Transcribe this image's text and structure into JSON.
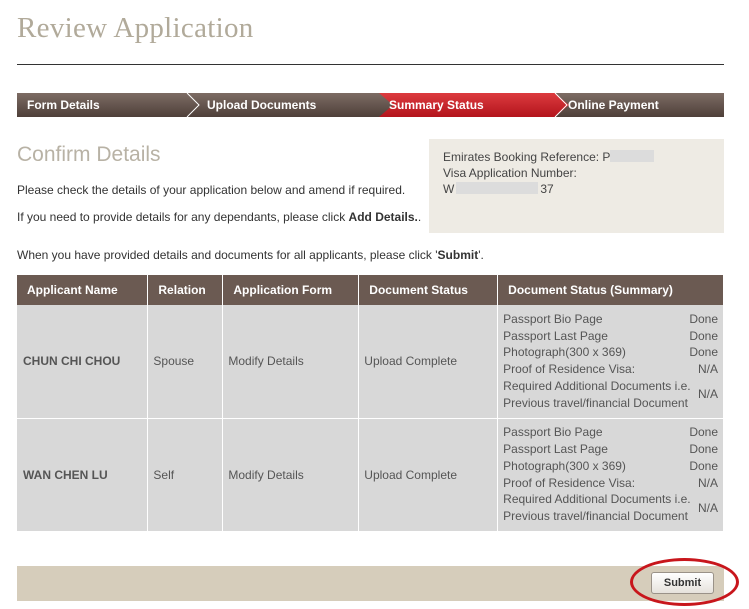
{
  "header": {
    "title": "Review Application"
  },
  "steps": [
    {
      "label": "Form Details",
      "active": false
    },
    {
      "label": "Upload Documents",
      "active": false
    },
    {
      "label": "Summary Status",
      "active": true
    },
    {
      "label": "Online Payment",
      "active": false
    }
  ],
  "confirm": {
    "title": "Confirm Details",
    "para1": "Please check the details of your application below and amend if required.",
    "para2_prefix": "If you need to provide details for any dependants, please click ",
    "para2_link": "Add Details.",
    "para2_suffix": ".",
    "para3_prefix": "When you have provided details and documents for all applicants, please click '",
    "para3_bold": "Submit",
    "para3_suffix": "'."
  },
  "booking": {
    "ref_label": "Emirates Booking Reference: P",
    "visa_label": "Visa Application Number:",
    "visa_prefix": "W",
    "visa_suffix": "37"
  },
  "table": {
    "headers": [
      "Applicant Name",
      "Relation",
      "Application Form",
      "Document Status",
      "Document Status (Summary)"
    ],
    "rows": [
      {
        "name": "CHUN CHI CHOU",
        "relation": "Spouse",
        "form": "Modify Details",
        "doc_status": "Upload Complete",
        "summary": [
          {
            "doc": "Passport Bio Page",
            "status": "Done"
          },
          {
            "doc": "Passport Last Page",
            "status": "Done"
          },
          {
            "doc": "Photograph(300 x 369)",
            "status": "Done"
          },
          {
            "doc": "Proof of Residence Visa:",
            "status": "N/A"
          },
          {
            "doc": "Required Additional Documents i.e. Previous travel/financial Document",
            "status": "N/A"
          }
        ]
      },
      {
        "name": "WAN CHEN LU",
        "relation": "Self",
        "form": "Modify Details",
        "doc_status": "Upload Complete",
        "summary": [
          {
            "doc": "Passport Bio Page",
            "status": "Done"
          },
          {
            "doc": "Passport Last Page",
            "status": "Done"
          },
          {
            "doc": "Photograph(300 x 369)",
            "status": "Done"
          },
          {
            "doc": "Proof of Residence Visa:",
            "status": "N/A"
          },
          {
            "doc": "Required Additional Documents i.e. Previous travel/financial Document",
            "status": "N/A"
          }
        ]
      }
    ]
  },
  "footer": {
    "submit_label": "Submit"
  },
  "colors": {
    "accent_red": "#c8161c",
    "header_brown": "#6b5a52",
    "title_beige": "#b1aa9a"
  }
}
